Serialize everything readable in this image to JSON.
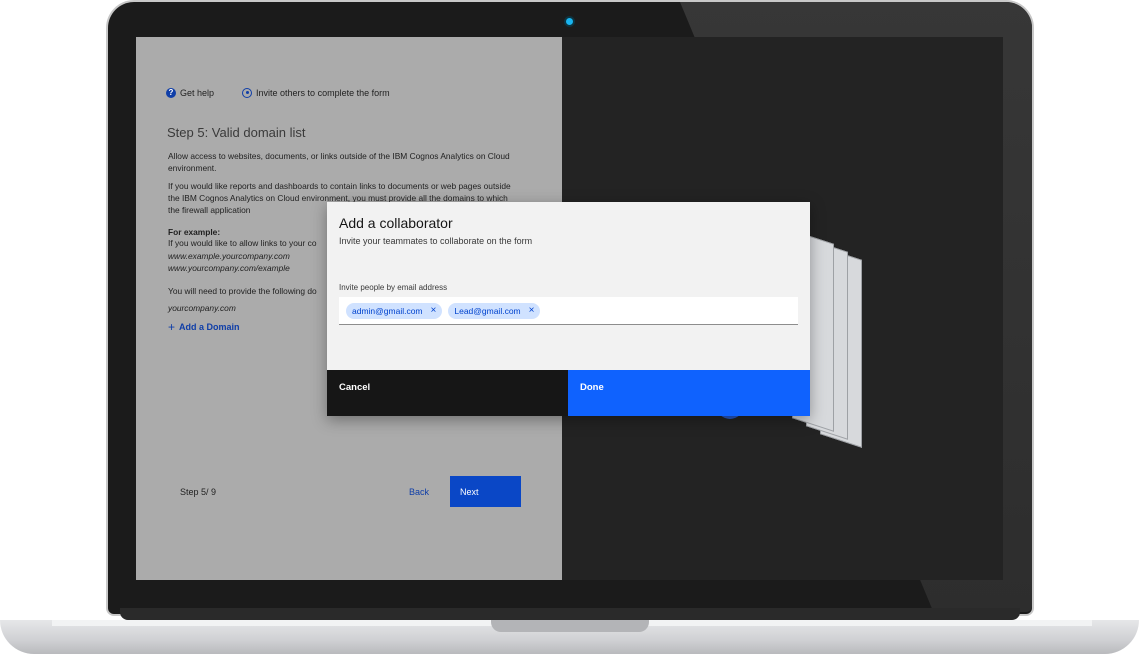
{
  "colors": {
    "primary_blue": "#0f62fe",
    "link_blue": "#0f3ea8",
    "tag_bg": "#d0e2ff",
    "screen_dark": "#232323"
  },
  "form": {
    "help_label": "Get help",
    "invite_label": "Invite others to complete the form",
    "step_title": "Step 5: Valid domain list",
    "para1": "Allow access to websites, documents, or links outside of the IBM Cognos Analytics on Cloud environment.",
    "para2": "If you would like reports and dashboards to contain links to documents or web pages outside the IBM Cognos Analytics on Cloud environment, you must provide all the domains to which the firewall application",
    "example_heading": "For example:",
    "example_text": "If you would like to allow links to your co",
    "example_url_1": "www.example.yourcompany.com",
    "example_url_2": "www.yourcompany.com/example",
    "provide_text": "You will need to provide the following do",
    "provide_domain": "yourcompany.com",
    "add_domain": "Add a Domain",
    "step_count": "Step 5/ 9",
    "back": "Back",
    "next": "Next"
  },
  "modal": {
    "title": "Add a collaborator",
    "subtitle": "Invite your teammates to collaborate on the form",
    "input_label": "Invite people by email address",
    "tags": [
      "admin@gmail.com",
      "Lead@gmail.com"
    ],
    "remove_glyph": "×",
    "cancel": "Cancel",
    "done": "Done"
  }
}
